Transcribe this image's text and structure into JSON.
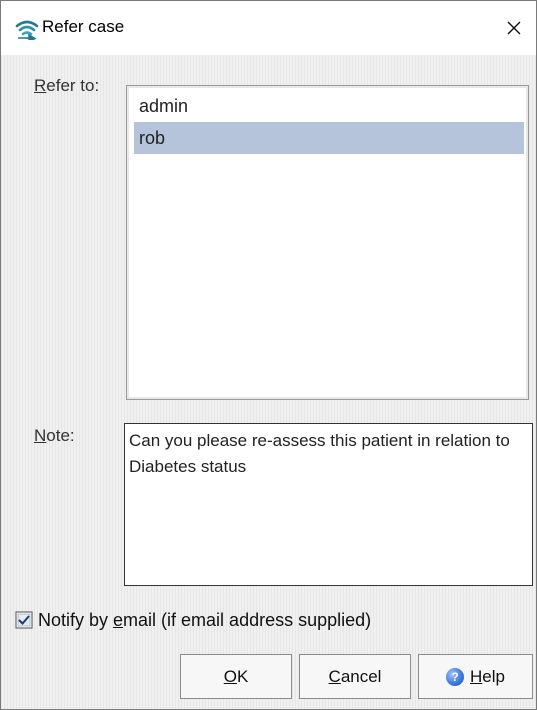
{
  "window": {
    "title": "Refer case"
  },
  "refer_to": {
    "label_accel": "R",
    "label_rest": "efer to:",
    "items": [
      "admin",
      "rob"
    ],
    "selected": "rob"
  },
  "note": {
    "label_accel": "N",
    "label_rest": "ote:",
    "value": "Can you please re-assess this patient in relation to Diabetes status"
  },
  "notify": {
    "checked": true,
    "label_pre": "Notify by ",
    "label_accel": "e",
    "label_post": "mail (if email address supplied)"
  },
  "buttons": {
    "ok_accel": "O",
    "ok_rest": "K",
    "cancel_accel": "C",
    "cancel_rest": "ancel",
    "help_accel": "H",
    "help_rest": "elp"
  },
  "colors": {
    "selection": "#b5c4da",
    "icon_teal": "#1f7a93"
  },
  "icons": {
    "app": "wifi-arrow-app-icon",
    "close": "close-icon",
    "checkbox": "checkbox-checked-icon",
    "help": "help-icon"
  }
}
